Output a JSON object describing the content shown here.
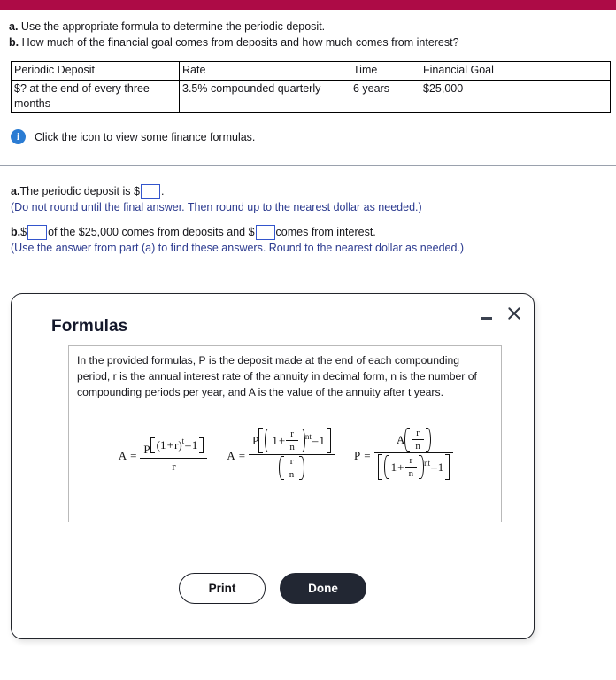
{
  "theme": {
    "banner_color": "#ad0b46",
    "info_icon_color": "#2b7cd3",
    "answer_text_color": "#2b3a8f",
    "done_button_color": "#222733"
  },
  "prompt": {
    "a_label": "a.",
    "a_text": " Use the appropriate formula to determine the periodic deposit.",
    "b_label": "b.",
    "b_text": " How much of the financial goal comes from deposits and how much comes from interest?"
  },
  "table": {
    "headers": [
      "Periodic Deposit",
      "Rate",
      "Time",
      "Financial Goal"
    ],
    "row": [
      "$? at the end of every three months",
      "3.5% compounded quarterly",
      "6 years",
      "$25,000"
    ]
  },
  "hint": {
    "icon": "info-icon",
    "text": "Click the icon to view some finance formulas."
  },
  "answers": {
    "a_label": "a.",
    "a_prefix": " The periodic deposit is $",
    "a_suffix": ".",
    "a_note": "(Do not round until the final answer. Then round up to the nearest dollar as needed.)",
    "b_label": "b.",
    "b_prefix": " $",
    "b_middle": " of the $25,000 comes from deposits and $",
    "b_suffix": " comes from interest.",
    "b_note": "(Use the answer from part (a) to find these answers. Round to the nearest dollar as needed.)",
    "input_a_value": "",
    "input_b1_value": "",
    "input_b2_value": ""
  },
  "dialog": {
    "title": "Formulas",
    "minimize_icon": "minimize-icon",
    "close_icon": "close-icon",
    "description": "In the provided formulas, P is the deposit made at the end of each compounding period, r is the annual interest rate of the annuity in decimal form, n is the number of compounding periods per year, and A is the value of the annuity after t years.",
    "formulas": [
      {
        "id": "formula-annual-annuity",
        "latex": "A = P[(1 + r)^t - 1] / r"
      },
      {
        "id": "formula-compound-annuity",
        "latex": "A = P[(1 + r/n)^(nt) - 1] / (r/n)"
      },
      {
        "id": "formula-periodic-deposit",
        "latex": "P = A(r/n) / [(1 + r/n)^(nt) - 1]"
      }
    ],
    "symbols": {
      "A": "A",
      "P": "P",
      "r": "r",
      "n": "n",
      "t": "t",
      "nt": "nt",
      "one": "1",
      "plus": "+",
      "minus": "–",
      "equals": "="
    },
    "print_label": "Print",
    "done_label": "Done"
  }
}
